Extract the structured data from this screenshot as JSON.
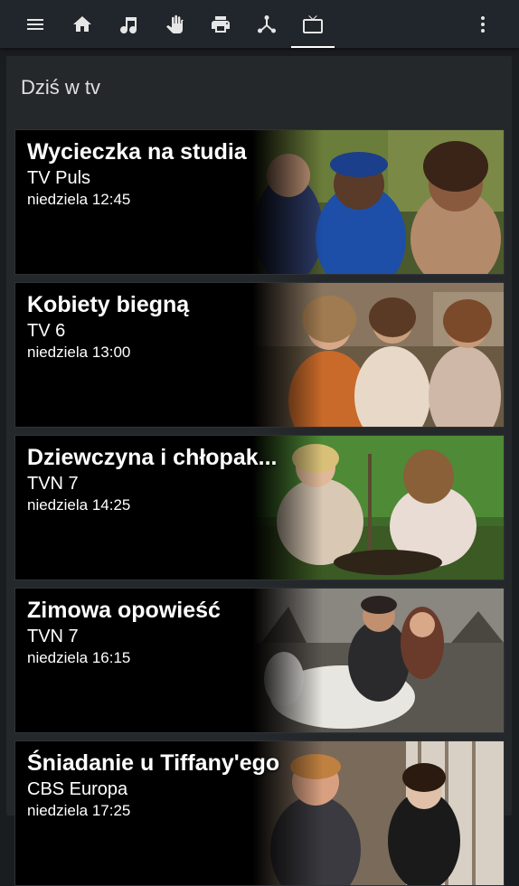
{
  "toolbar": {
    "items": [
      {
        "icon": "menu-icon"
      },
      {
        "icon": "home-icon"
      },
      {
        "icon": "music-note-icon"
      },
      {
        "icon": "hand-icon"
      },
      {
        "icon": "printer-icon"
      },
      {
        "icon": "network-icon"
      },
      {
        "icon": "tv-icon",
        "active": true
      },
      {
        "icon": "more-vert-icon"
      }
    ]
  },
  "section": {
    "title": "Dziś w tv"
  },
  "programs": [
    {
      "title": "Wycieczka na studia",
      "channel": "TV Puls",
      "time": "niedziela 12:45"
    },
    {
      "title": "Kobiety biegną",
      "channel": "TV 6",
      "time": "niedziela 13:00"
    },
    {
      "title": "Dziewczyna i chłopak...",
      "channel": "TVN 7",
      "time": "niedziela 14:25"
    },
    {
      "title": "Zimowa opowieść",
      "channel": "TVN 7",
      "time": "niedziela 16:15"
    },
    {
      "title": "Śniadanie u Tiffany'ego",
      "channel": "CBS Europa",
      "time": "niedziela 17:25"
    }
  ],
  "colors": {
    "topbar": "#20262c",
    "panel": "#25282b",
    "background": "#1a1d20",
    "accent": "#ffffff"
  }
}
